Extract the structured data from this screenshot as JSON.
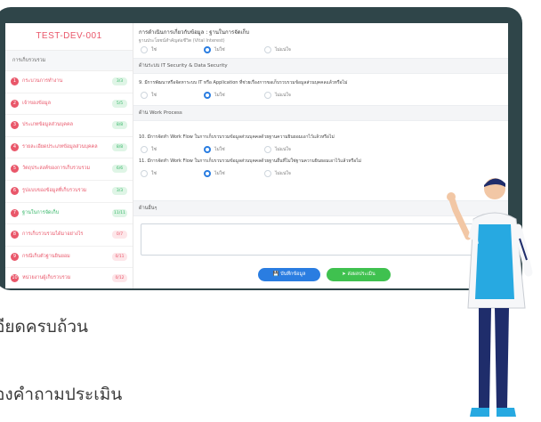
{
  "sidebar": {
    "title": "TEST-DEV-001",
    "section": "การเก็บรวบรวม",
    "items": [
      {
        "num": "1",
        "label": "กระบวนการทำงาน",
        "badge": "3/3",
        "status": "green"
      },
      {
        "num": "2",
        "label": "เจ้าของข้อมูล",
        "badge": "5/5",
        "status": "green"
      },
      {
        "num": "3",
        "label": "ประเภทข้อมูลส่วนบุคคล",
        "badge": "8/8",
        "status": "green"
      },
      {
        "num": "4",
        "label": "รายละเอียดประเภทข้อมูลส่วนบุคคล",
        "badge": "8/8",
        "status": "green"
      },
      {
        "num": "5",
        "label": "วัตถุประสงค์ของการเก็บรวบรวม",
        "badge": "6/6",
        "status": "green"
      },
      {
        "num": "6",
        "label": "รูปแบบของข้อมูลที่เก็บรวบรวม",
        "badge": "3/3",
        "status": "green"
      },
      {
        "num": "7",
        "label": "ฐานในการจัดเก็บ",
        "badge": "11/11",
        "status": "green",
        "active": true
      },
      {
        "num": "8",
        "label": "การเก็บรวบรวมได้มาอย่างไร",
        "badge": "0/7",
        "status": "red"
      },
      {
        "num": "9",
        "label": "กรณีเก็บตัวฐานยินยอม",
        "badge": "0/11",
        "status": "red"
      },
      {
        "num": "10",
        "label": "หน่วยงานผู้เก็บรวบรวม",
        "badge": "0/12",
        "status": "red"
      }
    ]
  },
  "main": {
    "header_title": "การดำเนินการเกี่ยวกับข้อมูล : ฐานในการจัดเก็บ",
    "header_sub": "ฐานประโยชน์สำคัญต่อชีวิต (Vital Interest)",
    "opt_yes": "ใช่",
    "opt_no": "ไม่ใช่",
    "opt_unknown": "ไม่แน่ใจ",
    "section_it": "ด้านระบบ IT Security & Data Security",
    "q9": "9. มีการพัฒนาหรือจัดหาระบบ IT หรือ Application ที่ช่วยเรื่องการขอเก็บรวบรวมข้อมูลส่วนบุคคลแล้วหรือไม่",
    "section_work": "ด้าน Work Process",
    "q10": "10. มีการจัดทำ Work Flow ในการเก็บรวบรวมข้อมูลส่วนบุคคลด้วยฐานความยินยอมเอาไว้แล้วหรือไม่",
    "q11": "11. มีการจัดทำ Work Flow ในการเก็บรวบรวมข้อมูลส่วนบุคคลด้วยฐานอื่นที่ไม่ใช่ฐานความยินยอมเอาไว้แล้วหรือไม่",
    "section_other": "ด้านอื่นๆ",
    "other_text": "",
    "save_label": "บันทึกข้อมูล",
    "send_label": "ส่งผลประเมิน"
  },
  "captions": {
    "line1": "อียดครบถ้วน",
    "line2": "องคำถามประเมิน"
  },
  "colors": {
    "frame": "#2f4549",
    "accent_red": "#e9576a",
    "accent_green": "#3fc14f",
    "accent_blue": "#2a7de1"
  }
}
